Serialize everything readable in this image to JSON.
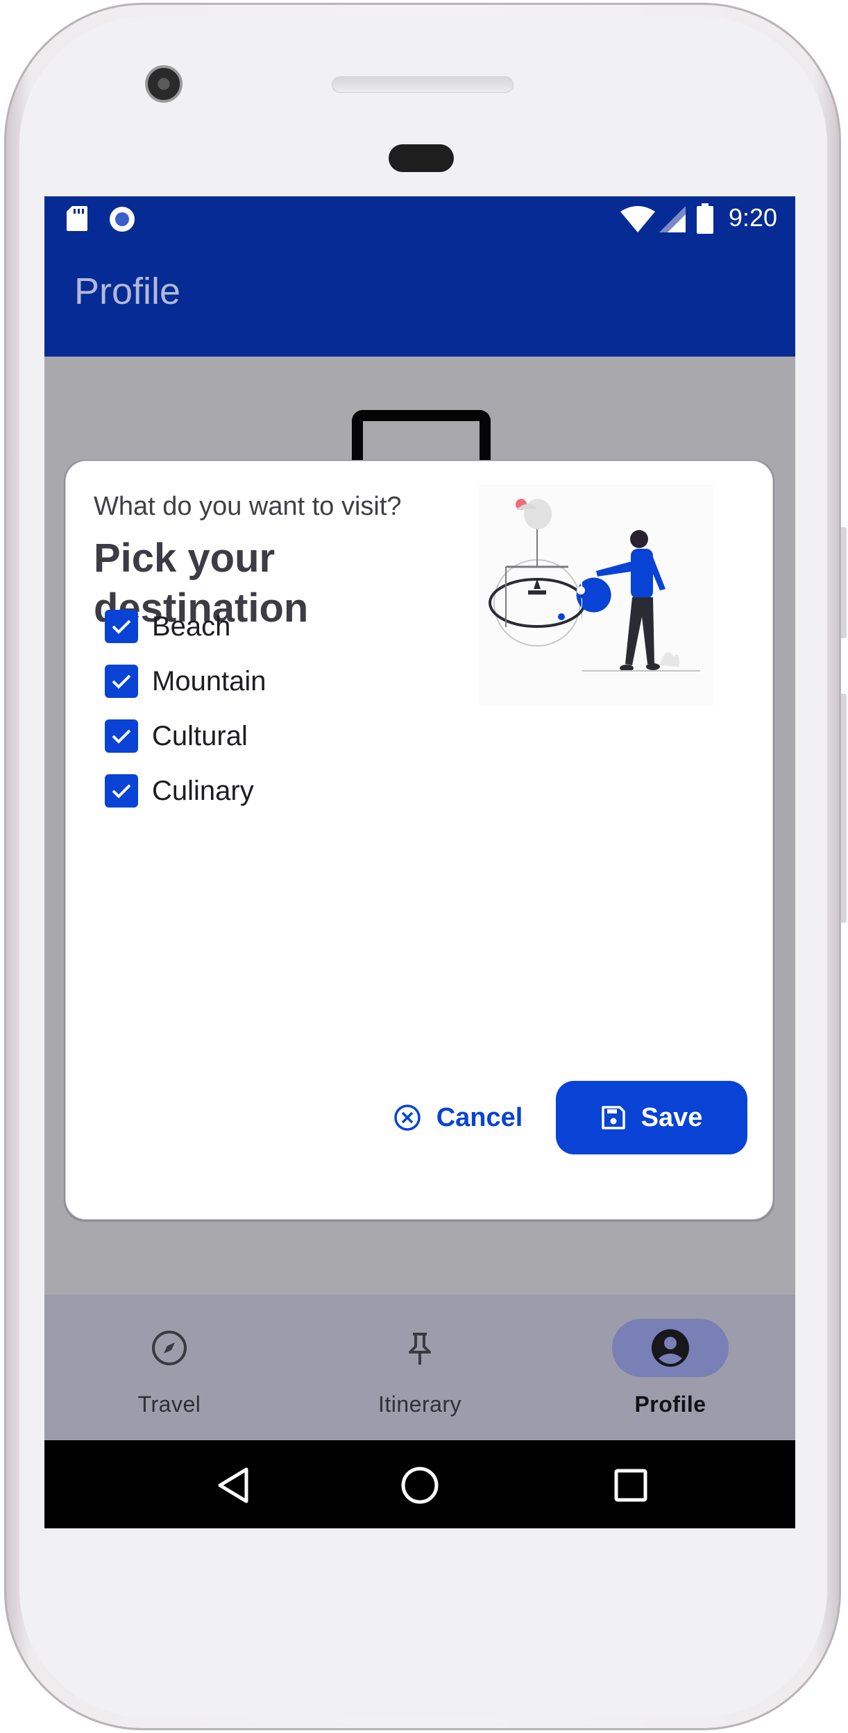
{
  "status_bar": {
    "time": "9:20",
    "left_icons": [
      "sd-card-icon",
      "circle-dot-icon"
    ],
    "right_icons": [
      "wifi-icon",
      "signal-icon",
      "battery-icon"
    ]
  },
  "app_bar": {
    "title": "Profile"
  },
  "dialog": {
    "subtitle": "What do you want to visit?",
    "title": "Pick your destination",
    "illustration_icon": "destination-illustration",
    "options": [
      {
        "label": "Beach",
        "checked": true
      },
      {
        "label": "Mountain",
        "checked": true
      },
      {
        "label": "Cultural",
        "checked": true
      },
      {
        "label": "Culinary",
        "checked": true
      }
    ],
    "cancel_label": "Cancel",
    "save_label": "Save"
  },
  "bottom_nav": {
    "items": [
      {
        "label": "Travel",
        "icon": "compass-icon",
        "active": false
      },
      {
        "label": "Itinerary",
        "icon": "pin-icon",
        "active": false
      },
      {
        "label": "Profile",
        "icon": "account-circle-icon",
        "active": true
      }
    ]
  },
  "system_nav": {
    "buttons": [
      "back-icon",
      "home-icon",
      "recents-icon"
    ]
  },
  "colors": {
    "primary": "#062b94",
    "accent": "#0843d6",
    "scrim": "#a9a8ad",
    "nav_background": "#9c9cab",
    "nav_active_pill": "#7880b5"
  }
}
